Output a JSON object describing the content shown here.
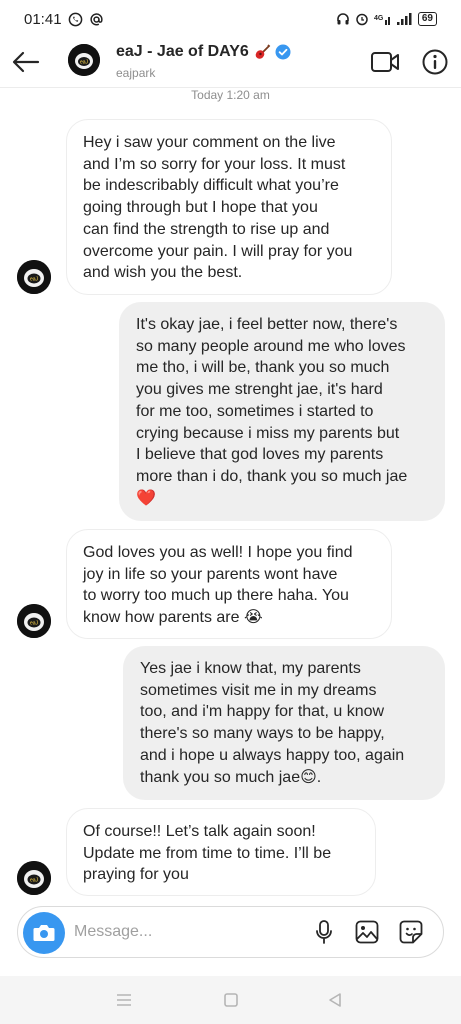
{
  "status_bar": {
    "time": "01:41",
    "left_icons": [
      "whatsapp-icon",
      "at-icon"
    ],
    "right_icons": [
      "headphones-icon",
      "alarm-icon",
      "signal-4g-icon",
      "signal-bars-icon"
    ],
    "battery": "69"
  },
  "header": {
    "name": "eaJ - Jae of DAY6",
    "username": "eajpark",
    "icons": [
      "back-arrow-icon",
      "guitar-icon",
      "verified-badge-icon",
      "video-call-icon",
      "info-icon"
    ]
  },
  "chat": {
    "timestamp": "Today 1:20 am",
    "messages": [
      {
        "from": "them",
        "lines": [
          "Hey i saw your comment on the live",
          "and I’m so sorry for your loss. It must",
          "be indescribably difficult what you’re",
          "going through but I hope that you",
          "can find the strength to rise up and",
          "overcome your pain. I will pray for you",
          "and wish you the best."
        ]
      },
      {
        "from": "me",
        "lines": [
          "It's okay jae, i feel better now, there's",
          "so many people around me who loves",
          "me tho, i will be, thank you so much",
          "you gives me strenght jae, it's hard",
          "for me too, sometimes i started to",
          "crying because i miss my parents but",
          "I believe that god loves my parents",
          "more than i do, thank you so much jae",
          "❤️"
        ]
      },
      {
        "from": "them",
        "lines": [
          "God loves you as well! I hope you find",
          "joy in life so your parents wont have",
          "to worry too much up there haha. You",
          "know how parents are 😭"
        ]
      },
      {
        "from": "me",
        "lines": [
          "Yes jae i know that, my parents",
          "sometimes visit me in my dreams",
          "too, and i'm happy for that, u know",
          "there's so many ways to be happy,",
          "and i hope u always happy too, again",
          "thank you so much jae😊."
        ]
      },
      {
        "from": "them",
        "lines": [
          "Of course!! Let’s talk again soon!",
          "Update me from time to time. I’ll be",
          "praying for you"
        ]
      }
    ]
  },
  "composer": {
    "placeholder": "Message...",
    "icons": [
      "camera-icon",
      "microphone-icon",
      "gallery-icon",
      "sticker-icon"
    ]
  },
  "nav_bar": {
    "icons": [
      "menu-icon",
      "home-icon",
      "back-icon"
    ]
  },
  "colors": {
    "accent_blue": "#3897f0",
    "verified_blue": "#3897f0",
    "incoming_bubble": "#ffffff",
    "outgoing_bubble": "#efefef",
    "heart_red": "#e0245e"
  }
}
